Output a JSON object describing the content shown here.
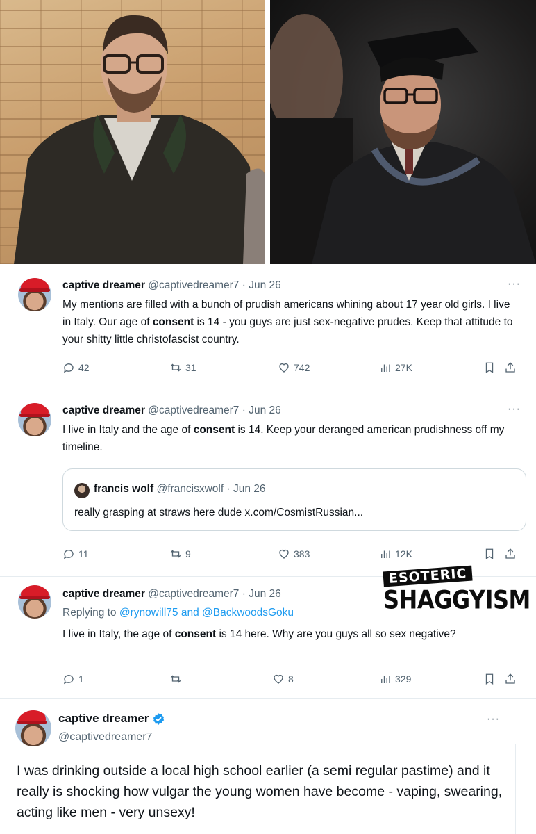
{
  "tweet1": {
    "name": "captive dreamer",
    "handle": "@captivedreamer7",
    "separator": "·",
    "date": "Jun 26",
    "more": "···",
    "text_a": "My mentions are filled with a bunch of prudish americans whining about 17 year old girls.  I live in Italy.  Our age of ",
    "text_bold": "consent",
    "text_b": " is 14 - you guys are just sex-negative prudes.  Keep that attitude to your shitty little christofascist country.",
    "replies": "42",
    "retweets": "31",
    "likes": "742",
    "views": "27K"
  },
  "tweet2": {
    "name": "captive dreamer",
    "handle": "@captivedreamer7",
    "separator": "·",
    "date": "Jun 26",
    "more": "···",
    "text_a": "I live in Italy and the age of ",
    "text_bold": "consent",
    "text_b": " is 14.  Keep your deranged american prudishness off my timeline.",
    "quote": {
      "name": "francis wolf",
      "handle": "@francisxwolf",
      "separator": "·",
      "date": "Jun 26",
      "text": "really grasping at straws here dude x.com/CosmistRussian..."
    },
    "replies": "11",
    "retweets": "9",
    "likes": "383",
    "views": "12K"
  },
  "tweet3": {
    "name": "captive dreamer",
    "handle": "@captivedreamer7",
    "separator": "·",
    "date": "Jun 26",
    "replying_prefix": "Replying to ",
    "reply_user1": "@rynowill75",
    "reply_and": " and ",
    "reply_user2": "@BackwoodsGoku",
    "text_a": "I live in Italy, the age of ",
    "text_bold": "consent",
    "text_b": " is 14 here.  Why are you guys all so sex negative?",
    "replies": "1",
    "likes": "8",
    "views": "329"
  },
  "watermark": {
    "top": "ESOTERIC",
    "bottom": "SHAGGYISM"
  },
  "tweet4": {
    "name": "captive dreamer",
    "handle": "@captivedreamer7",
    "more": "···",
    "text": "I was drinking outside a local high school earlier (a semi regular pastime) and it really is shocking how vulgar the young women have become - vaping, swearing, acting like men - very unsexy!"
  },
  "colors": {
    "link": "#1d9bf0",
    "secondary_text": "#536471",
    "verified": "#1d9bf0",
    "hat_red": "#d81c28"
  },
  "icons": [
    "reply-icon",
    "retweet-icon",
    "like-icon",
    "views-icon",
    "bookmark-icon",
    "share-icon",
    "verified-badge-icon",
    "more-icon"
  ]
}
